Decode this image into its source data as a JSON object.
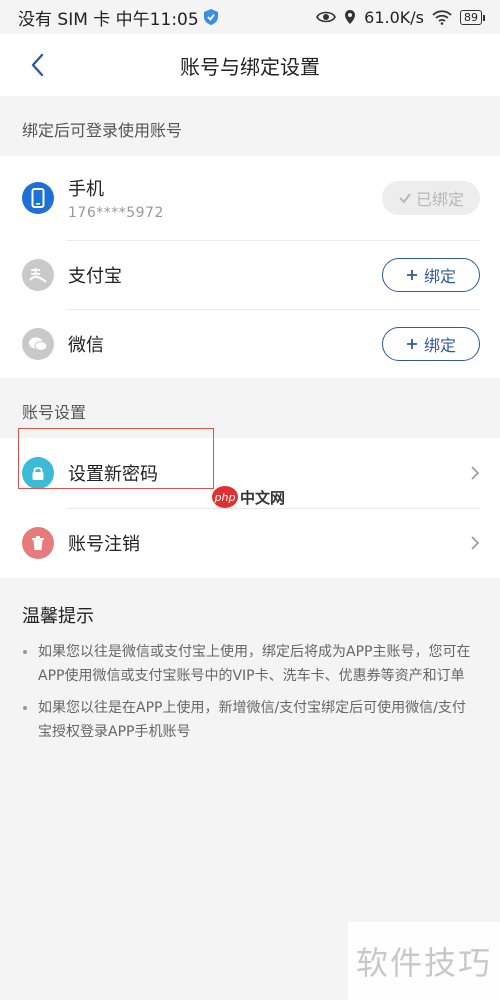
{
  "status_bar": {
    "left_text": "没有 SIM 卡 中午11:05",
    "speed": "61.0K/s",
    "battery": "89"
  },
  "navbar": {
    "title": "账号与绑定设置"
  },
  "section_bind": {
    "title": "绑定后可登录使用账号",
    "items": [
      {
        "name": "手机",
        "sub": "176****5972",
        "action": "已绑定",
        "state": "bound",
        "color": "#1e6fd6"
      },
      {
        "name": "支付宝",
        "action": "绑定",
        "state": "unbound",
        "color": "#c9c9c9"
      },
      {
        "name": "微信",
        "action": "绑定",
        "state": "unbound",
        "color": "#c9c9c9"
      }
    ]
  },
  "section_account": {
    "title": "账号设置",
    "items": [
      {
        "name": "设置新密码",
        "color": "#3bbbd6"
      },
      {
        "name": "账号注销",
        "color": "#e77a7a"
      }
    ]
  },
  "tips": {
    "title": "温馨提示",
    "items": [
      "如果您以往是微信或支付宝上使用，绑定后将成为APP主账号，您可在APP使用微信或支付宝账号中的VIP卡、洗车卡、优惠券等资产和订单",
      "如果您以往是在APP上使用，新增微信/支付宝绑定后可使用微信/支付宝授权登录APP手机账号"
    ]
  },
  "watermarks": {
    "php_badge": "php",
    "php_text": "中文网",
    "corner_text": "软件技巧"
  },
  "highlight_color": "#d9534f"
}
